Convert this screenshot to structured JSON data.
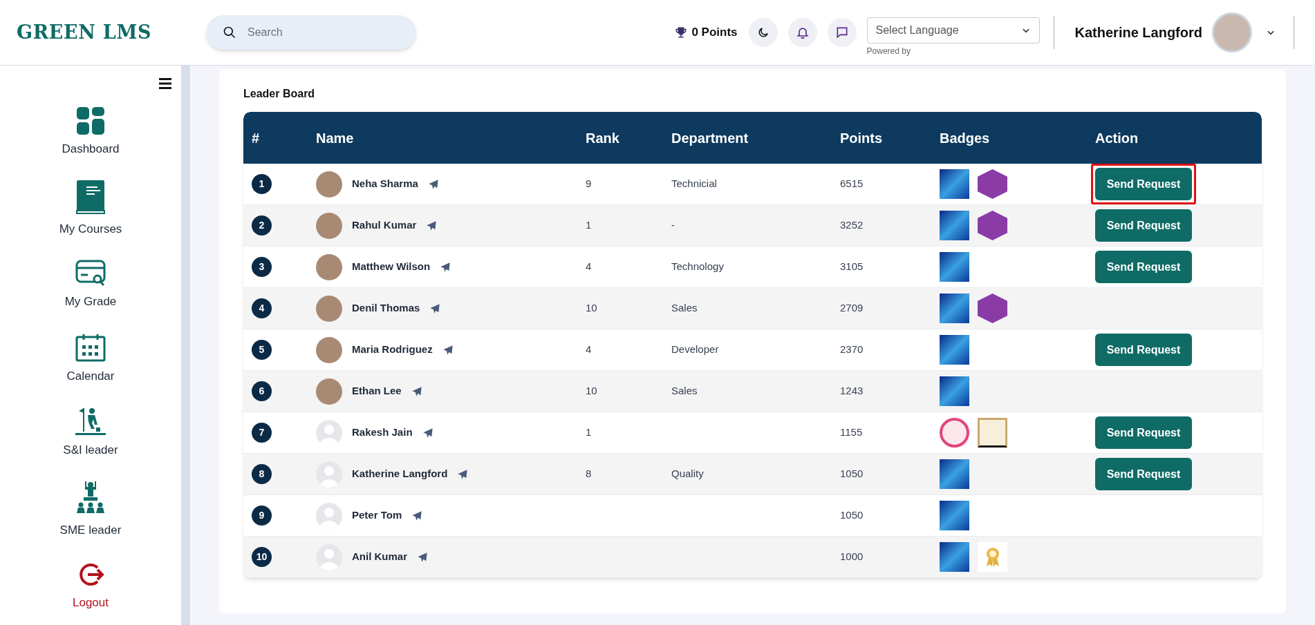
{
  "header": {
    "logo": "GREEN LMS",
    "search": {
      "placeholder": "Search"
    },
    "points": "0 Points",
    "language_select": "Select Language",
    "powered_by": "Powered by",
    "user_name": "Katherine Langford"
  },
  "sidebar": {
    "items": [
      {
        "label": "Dashboard",
        "kind": "grid"
      },
      {
        "label": "My Courses",
        "kind": "book"
      },
      {
        "label": "My Grade",
        "kind": "card"
      },
      {
        "label": "Calendar",
        "kind": "calendar"
      },
      {
        "label": "S&I leader",
        "kind": "climber"
      },
      {
        "label": "SME leader",
        "kind": "team"
      },
      {
        "label": "Logout",
        "kind": "logout"
      }
    ]
  },
  "leaderboard": {
    "title": "Leader Board",
    "columns": [
      "#",
      "Name",
      "Rank",
      "Department",
      "Points",
      "Badges",
      "Action"
    ],
    "rows": [
      {
        "number": "1",
        "name": "Neha Sharma",
        "avatar": {
          "kind": "photo"
        },
        "rank": "9",
        "department": "Technicial",
        "points": "6515",
        "badges": [
          {
            "kind": "robot"
          },
          {
            "kind": "profile"
          }
        ],
        "action": "Send Request",
        "highlighted": true
      },
      {
        "number": "2",
        "name": "Rahul Kumar",
        "avatar": {
          "kind": "photo"
        },
        "rank": "1",
        "department": "-",
        "points": "3252",
        "badges": [
          {
            "kind": "robot"
          },
          {
            "kind": "profile"
          }
        ],
        "action": "Send Request",
        "highlighted": false
      },
      {
        "number": "3",
        "name": "Matthew Wilson",
        "avatar": {
          "kind": "photo"
        },
        "rank": "4",
        "department": "Technology",
        "points": "3105",
        "badges": [
          {
            "kind": "robot"
          }
        ],
        "action": "Send Request",
        "highlighted": false
      },
      {
        "number": "4",
        "name": "Denil Thomas",
        "avatar": {
          "kind": "photo"
        },
        "rank": "10",
        "department": "Sales",
        "points": "2709",
        "badges": [
          {
            "kind": "robot"
          },
          {
            "kind": "profile"
          }
        ]
      },
      {
        "number": "5",
        "name": "Maria Rodriguez",
        "avatar": {
          "kind": "photo"
        },
        "rank": "4",
        "department": "Developer",
        "points": "2370",
        "badges": [
          {
            "kind": "robot"
          }
        ],
        "action": "Send Request",
        "highlighted": false
      },
      {
        "number": "6",
        "name": "Ethan Lee",
        "avatar": {
          "kind": "photo"
        },
        "rank": "10",
        "department": "Sales",
        "points": "1243",
        "badges": [
          {
            "kind": "robot"
          }
        ]
      },
      {
        "number": "7",
        "name": "Rakesh Jain",
        "avatar": {
          "kind": "default"
        },
        "rank": "1",
        "points": "1155",
        "badges": [
          {
            "kind": "trophy"
          },
          {
            "kind": "certificate"
          }
        ],
        "action": "Send Request",
        "highlighted": false
      },
      {
        "number": "8",
        "name": "Katherine Langford",
        "avatar": {
          "kind": "default"
        },
        "rank": "8",
        "department": "Quality",
        "points": "1050",
        "badges": [
          {
            "kind": "robot"
          }
        ],
        "action": "Send Request",
        "highlighted": false
      },
      {
        "number": "9",
        "name": "Peter Tom",
        "avatar": {
          "kind": "default"
        },
        "points": "1050",
        "badges": [
          {
            "kind": "robot"
          }
        ]
      },
      {
        "number": "10",
        "name": "Anil Kumar",
        "avatar": {
          "kind": "default"
        },
        "points": "1000",
        "badges": [
          {
            "kind": "robot"
          },
          {
            "kind": "medal"
          }
        ]
      }
    ]
  }
}
